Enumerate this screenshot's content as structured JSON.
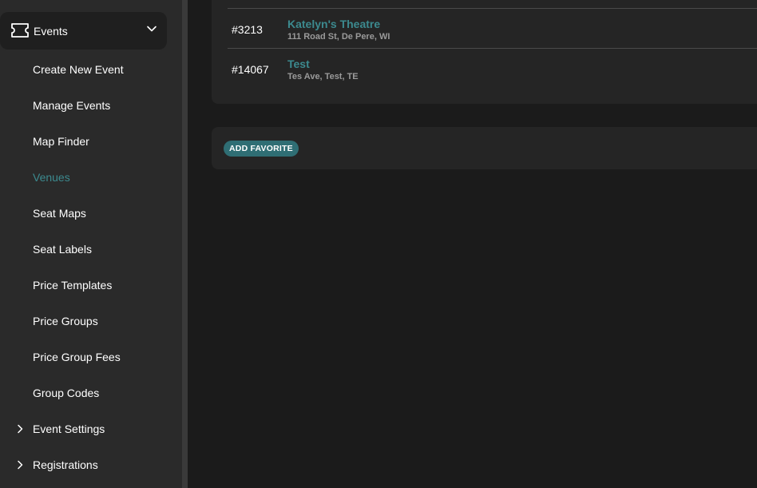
{
  "sidebar": {
    "section": {
      "label": "Events",
      "icon": "ticket-icon",
      "expanded": true
    },
    "items": [
      {
        "label": "Create New Event"
      },
      {
        "label": "Manage Events"
      },
      {
        "label": "Map Finder"
      },
      {
        "label": "Venues",
        "active": true
      },
      {
        "label": "Seat Maps"
      },
      {
        "label": "Seat Labels"
      },
      {
        "label": "Price Templates"
      },
      {
        "label": "Price Groups"
      },
      {
        "label": "Price Group Fees"
      },
      {
        "label": "Group Codes"
      },
      {
        "label": "Event Settings",
        "expandable": true
      },
      {
        "label": "Registrations",
        "expandable": true
      }
    ]
  },
  "venues": {
    "rows": [
      {
        "id": "#3213",
        "name": "Katelyn's Theatre",
        "address": "111 Road St, De Pere, WI"
      },
      {
        "id": "#14067",
        "name": "Test",
        "address": "Tes Ave, Test, TE"
      }
    ]
  },
  "favorites": {
    "add_button_label": "ADD FAVORITE"
  },
  "colors": {
    "accent": "#3c8a8f",
    "button": "#2f6e74",
    "sidebar_bg": "#2a2a2a",
    "main_bg": "#1b1b1b",
    "card_bg": "#252525"
  }
}
